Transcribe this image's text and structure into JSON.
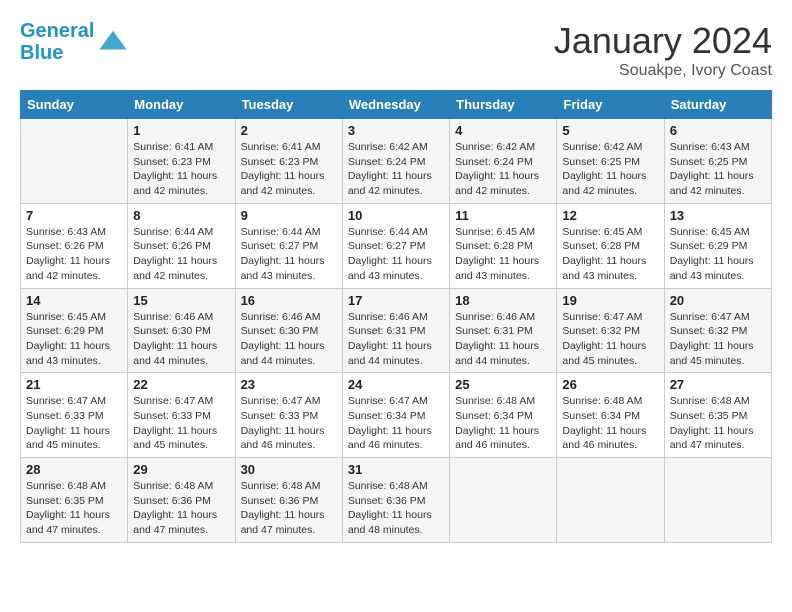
{
  "header": {
    "logo_line1": "General",
    "logo_line2": "Blue",
    "month": "January 2024",
    "location": "Souakpe, Ivory Coast"
  },
  "weekdays": [
    "Sunday",
    "Monday",
    "Tuesday",
    "Wednesday",
    "Thursday",
    "Friday",
    "Saturday"
  ],
  "weeks": [
    [
      {
        "day": "",
        "sunrise": "",
        "sunset": "",
        "daylight": ""
      },
      {
        "day": "1",
        "sunrise": "Sunrise: 6:41 AM",
        "sunset": "Sunset: 6:23 PM",
        "daylight": "Daylight: 11 hours and 42 minutes."
      },
      {
        "day": "2",
        "sunrise": "Sunrise: 6:41 AM",
        "sunset": "Sunset: 6:23 PM",
        "daylight": "Daylight: 11 hours and 42 minutes."
      },
      {
        "day": "3",
        "sunrise": "Sunrise: 6:42 AM",
        "sunset": "Sunset: 6:24 PM",
        "daylight": "Daylight: 11 hours and 42 minutes."
      },
      {
        "day": "4",
        "sunrise": "Sunrise: 6:42 AM",
        "sunset": "Sunset: 6:24 PM",
        "daylight": "Daylight: 11 hours and 42 minutes."
      },
      {
        "day": "5",
        "sunrise": "Sunrise: 6:42 AM",
        "sunset": "Sunset: 6:25 PM",
        "daylight": "Daylight: 11 hours and 42 minutes."
      },
      {
        "day": "6",
        "sunrise": "Sunrise: 6:43 AM",
        "sunset": "Sunset: 6:25 PM",
        "daylight": "Daylight: 11 hours and 42 minutes."
      }
    ],
    [
      {
        "day": "7",
        "sunrise": "Sunrise: 6:43 AM",
        "sunset": "Sunset: 6:26 PM",
        "daylight": "Daylight: 11 hours and 42 minutes."
      },
      {
        "day": "8",
        "sunrise": "Sunrise: 6:44 AM",
        "sunset": "Sunset: 6:26 PM",
        "daylight": "Daylight: 11 hours and 42 minutes."
      },
      {
        "day": "9",
        "sunrise": "Sunrise: 6:44 AM",
        "sunset": "Sunset: 6:27 PM",
        "daylight": "Daylight: 11 hours and 43 minutes."
      },
      {
        "day": "10",
        "sunrise": "Sunrise: 6:44 AM",
        "sunset": "Sunset: 6:27 PM",
        "daylight": "Daylight: 11 hours and 43 minutes."
      },
      {
        "day": "11",
        "sunrise": "Sunrise: 6:45 AM",
        "sunset": "Sunset: 6:28 PM",
        "daylight": "Daylight: 11 hours and 43 minutes."
      },
      {
        "day": "12",
        "sunrise": "Sunrise: 6:45 AM",
        "sunset": "Sunset: 6:28 PM",
        "daylight": "Daylight: 11 hours and 43 minutes."
      },
      {
        "day": "13",
        "sunrise": "Sunrise: 6:45 AM",
        "sunset": "Sunset: 6:29 PM",
        "daylight": "Daylight: 11 hours and 43 minutes."
      }
    ],
    [
      {
        "day": "14",
        "sunrise": "Sunrise: 6:45 AM",
        "sunset": "Sunset: 6:29 PM",
        "daylight": "Daylight: 11 hours and 43 minutes."
      },
      {
        "day": "15",
        "sunrise": "Sunrise: 6:46 AM",
        "sunset": "Sunset: 6:30 PM",
        "daylight": "Daylight: 11 hours and 44 minutes."
      },
      {
        "day": "16",
        "sunrise": "Sunrise: 6:46 AM",
        "sunset": "Sunset: 6:30 PM",
        "daylight": "Daylight: 11 hours and 44 minutes."
      },
      {
        "day": "17",
        "sunrise": "Sunrise: 6:46 AM",
        "sunset": "Sunset: 6:31 PM",
        "daylight": "Daylight: 11 hours and 44 minutes."
      },
      {
        "day": "18",
        "sunrise": "Sunrise: 6:46 AM",
        "sunset": "Sunset: 6:31 PM",
        "daylight": "Daylight: 11 hours and 44 minutes."
      },
      {
        "day": "19",
        "sunrise": "Sunrise: 6:47 AM",
        "sunset": "Sunset: 6:32 PM",
        "daylight": "Daylight: 11 hours and 45 minutes."
      },
      {
        "day": "20",
        "sunrise": "Sunrise: 6:47 AM",
        "sunset": "Sunset: 6:32 PM",
        "daylight": "Daylight: 11 hours and 45 minutes."
      }
    ],
    [
      {
        "day": "21",
        "sunrise": "Sunrise: 6:47 AM",
        "sunset": "Sunset: 6:33 PM",
        "daylight": "Daylight: 11 hours and 45 minutes."
      },
      {
        "day": "22",
        "sunrise": "Sunrise: 6:47 AM",
        "sunset": "Sunset: 6:33 PM",
        "daylight": "Daylight: 11 hours and 45 minutes."
      },
      {
        "day": "23",
        "sunrise": "Sunrise: 6:47 AM",
        "sunset": "Sunset: 6:33 PM",
        "daylight": "Daylight: 11 hours and 46 minutes."
      },
      {
        "day": "24",
        "sunrise": "Sunrise: 6:47 AM",
        "sunset": "Sunset: 6:34 PM",
        "daylight": "Daylight: 11 hours and 46 minutes."
      },
      {
        "day": "25",
        "sunrise": "Sunrise: 6:48 AM",
        "sunset": "Sunset: 6:34 PM",
        "daylight": "Daylight: 11 hours and 46 minutes."
      },
      {
        "day": "26",
        "sunrise": "Sunrise: 6:48 AM",
        "sunset": "Sunset: 6:34 PM",
        "daylight": "Daylight: 11 hours and 46 minutes."
      },
      {
        "day": "27",
        "sunrise": "Sunrise: 6:48 AM",
        "sunset": "Sunset: 6:35 PM",
        "daylight": "Daylight: 11 hours and 47 minutes."
      }
    ],
    [
      {
        "day": "28",
        "sunrise": "Sunrise: 6:48 AM",
        "sunset": "Sunset: 6:35 PM",
        "daylight": "Daylight: 11 hours and 47 minutes."
      },
      {
        "day": "29",
        "sunrise": "Sunrise: 6:48 AM",
        "sunset": "Sunset: 6:36 PM",
        "daylight": "Daylight: 11 hours and 47 minutes."
      },
      {
        "day": "30",
        "sunrise": "Sunrise: 6:48 AM",
        "sunset": "Sunset: 6:36 PM",
        "daylight": "Daylight: 11 hours and 47 minutes."
      },
      {
        "day": "31",
        "sunrise": "Sunrise: 6:48 AM",
        "sunset": "Sunset: 6:36 PM",
        "daylight": "Daylight: 11 hours and 48 minutes."
      },
      {
        "day": "",
        "sunrise": "",
        "sunset": "",
        "daylight": ""
      },
      {
        "day": "",
        "sunrise": "",
        "sunset": "",
        "daylight": ""
      },
      {
        "day": "",
        "sunrise": "",
        "sunset": "",
        "daylight": ""
      }
    ]
  ]
}
